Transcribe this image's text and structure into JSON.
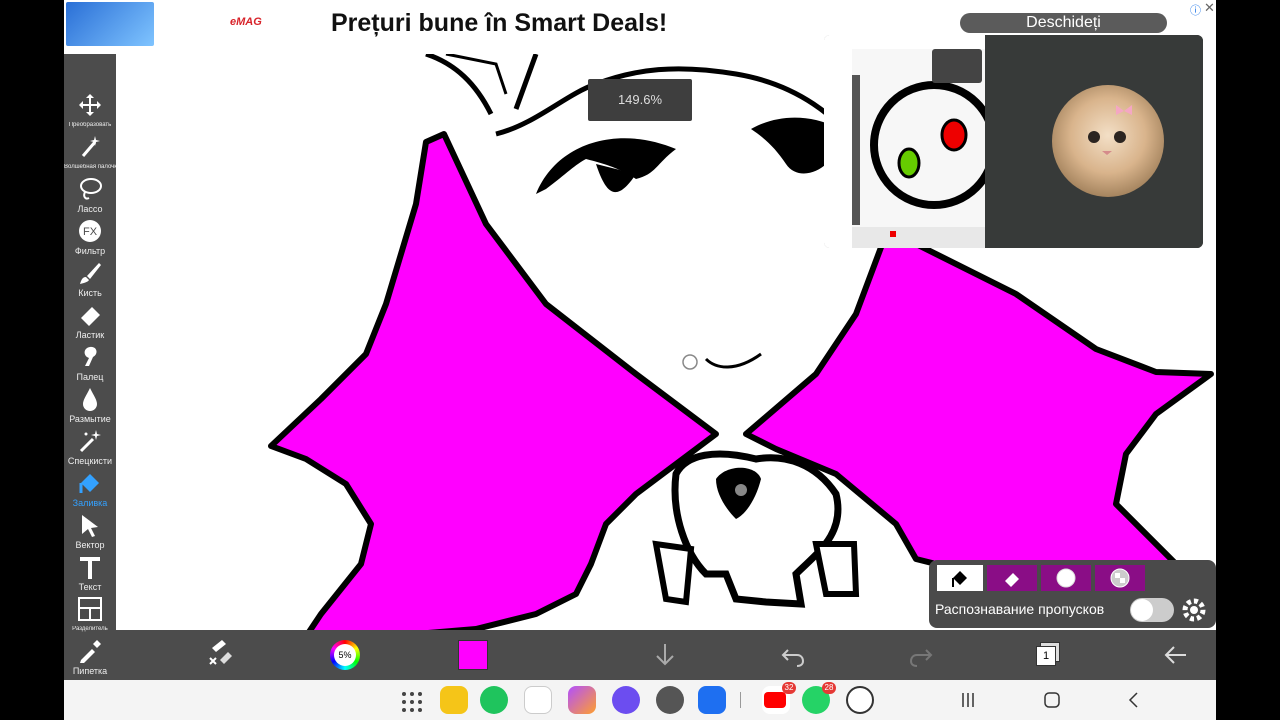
{
  "ad": {
    "brand_logo": "eMAG",
    "title": "Prețuri bune în Smart Deals!",
    "cta": "Deschideți",
    "info_icon": "info-icon",
    "close_icon": "close-icon"
  },
  "canvas": {
    "zoom": "149.6%",
    "fill_color": "#ff00ff"
  },
  "toolbar": {
    "items": [
      {
        "label": "Преобразовать",
        "icon": "move-arrows-icon"
      },
      {
        "label": "Волшебная палочка",
        "icon": "magic-wand-icon"
      },
      {
        "label": "Лассо",
        "icon": "lasso-icon"
      },
      {
        "label": "Фильтр",
        "icon": "fx-icon"
      },
      {
        "label": "Кисть",
        "icon": "brush-icon"
      },
      {
        "label": "Ластик",
        "icon": "eraser-icon"
      },
      {
        "label": "Палец",
        "icon": "smudge-finger-icon"
      },
      {
        "label": "Размытие",
        "icon": "blur-drop-icon"
      },
      {
        "label": "Спецкисти",
        "icon": "special-brush-icon"
      },
      {
        "label": "Заливка",
        "icon": "fill-bucket-icon"
      },
      {
        "label": "Вектор",
        "icon": "vector-cursor-icon"
      },
      {
        "label": "Текст",
        "icon": "text-icon"
      },
      {
        "label": "Разделитель",
        "icon": "frame-divider-icon"
      },
      {
        "label": "Пипетка",
        "icon": "eyedropper-icon"
      }
    ]
  },
  "bottom_bar": {
    "brush_size": "5%",
    "current_color": "#ff00ff",
    "layer_count": "1"
  },
  "fill_panel": {
    "gap_label": "Распознавание пропусков",
    "gap_enabled": false
  },
  "taskbar": {
    "youtube_badge": "32",
    "whatsapp_badge": "28"
  },
  "colors": {
    "accent_blue": "#33a1ff",
    "magenta": "#ff00ff",
    "panel_purple": "#8a0d86"
  }
}
